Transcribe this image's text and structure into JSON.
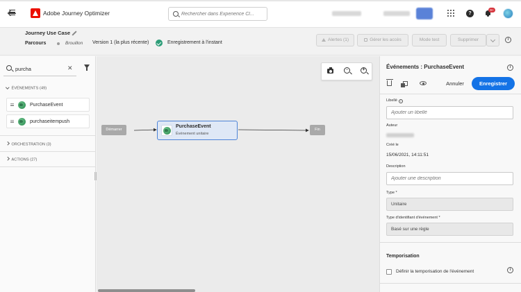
{
  "topbar": {
    "app_title": "Adobe Journey Optimizer",
    "search_placeholder": "Rechercher dans Experience Cl...",
    "notification_count": "9+"
  },
  "journey": {
    "name": "Journey Use Case",
    "type": "Parcours",
    "status": "Brouillon",
    "version": "Version 1 (la plus récente)",
    "saved": "Enregistrement à l'instant",
    "buttons": {
      "alerts": "Alertes (1)",
      "manage_access": "Gérer les accès",
      "test_mode": "Mode test",
      "delete": "Supprimer"
    }
  },
  "left_panel": {
    "search_value": "purcha",
    "categories": [
      {
        "label": "ÉVÉNEMENTS (49)",
        "expanded": true,
        "items": [
          "PurchaseEvent",
          "purchaseitempush"
        ]
      },
      {
        "label": "ORCHESTRATION (3)",
        "expanded": false
      },
      {
        "label": "ACTIONS (27)",
        "expanded": false
      }
    ]
  },
  "canvas": {
    "start_label": "Démarrer",
    "end_label": "Fin",
    "event_node": {
      "title": "PurchaseEvent",
      "subtitle": "Événement unitaire"
    }
  },
  "right_panel": {
    "title": "Événements : PurchaseEvent",
    "cancel": "Annuler",
    "save": "Enregistrer",
    "label_label": "Libellé",
    "label_placeholder": "Ajouter un libellé",
    "author_label": "Auteur",
    "created_label": "Créé le",
    "created_value": "15/06/2021, 14:11:51",
    "description_label": "Description",
    "description_placeholder": "Ajouter une description",
    "type_label": "Type",
    "type_value": "Unitaire",
    "id_type_label": "Type d'identifiant d'événement",
    "id_type_value": "Basé sur une règle",
    "timing_title": "Temporisation",
    "timing_checkbox": "Définir la temporisation de l'événement",
    "required_mark": "*"
  },
  "colors": {
    "accent": "#1473e6",
    "success": "#2d9d78",
    "adobe_red": "#eb1000",
    "node_border": "#4c83d7"
  }
}
